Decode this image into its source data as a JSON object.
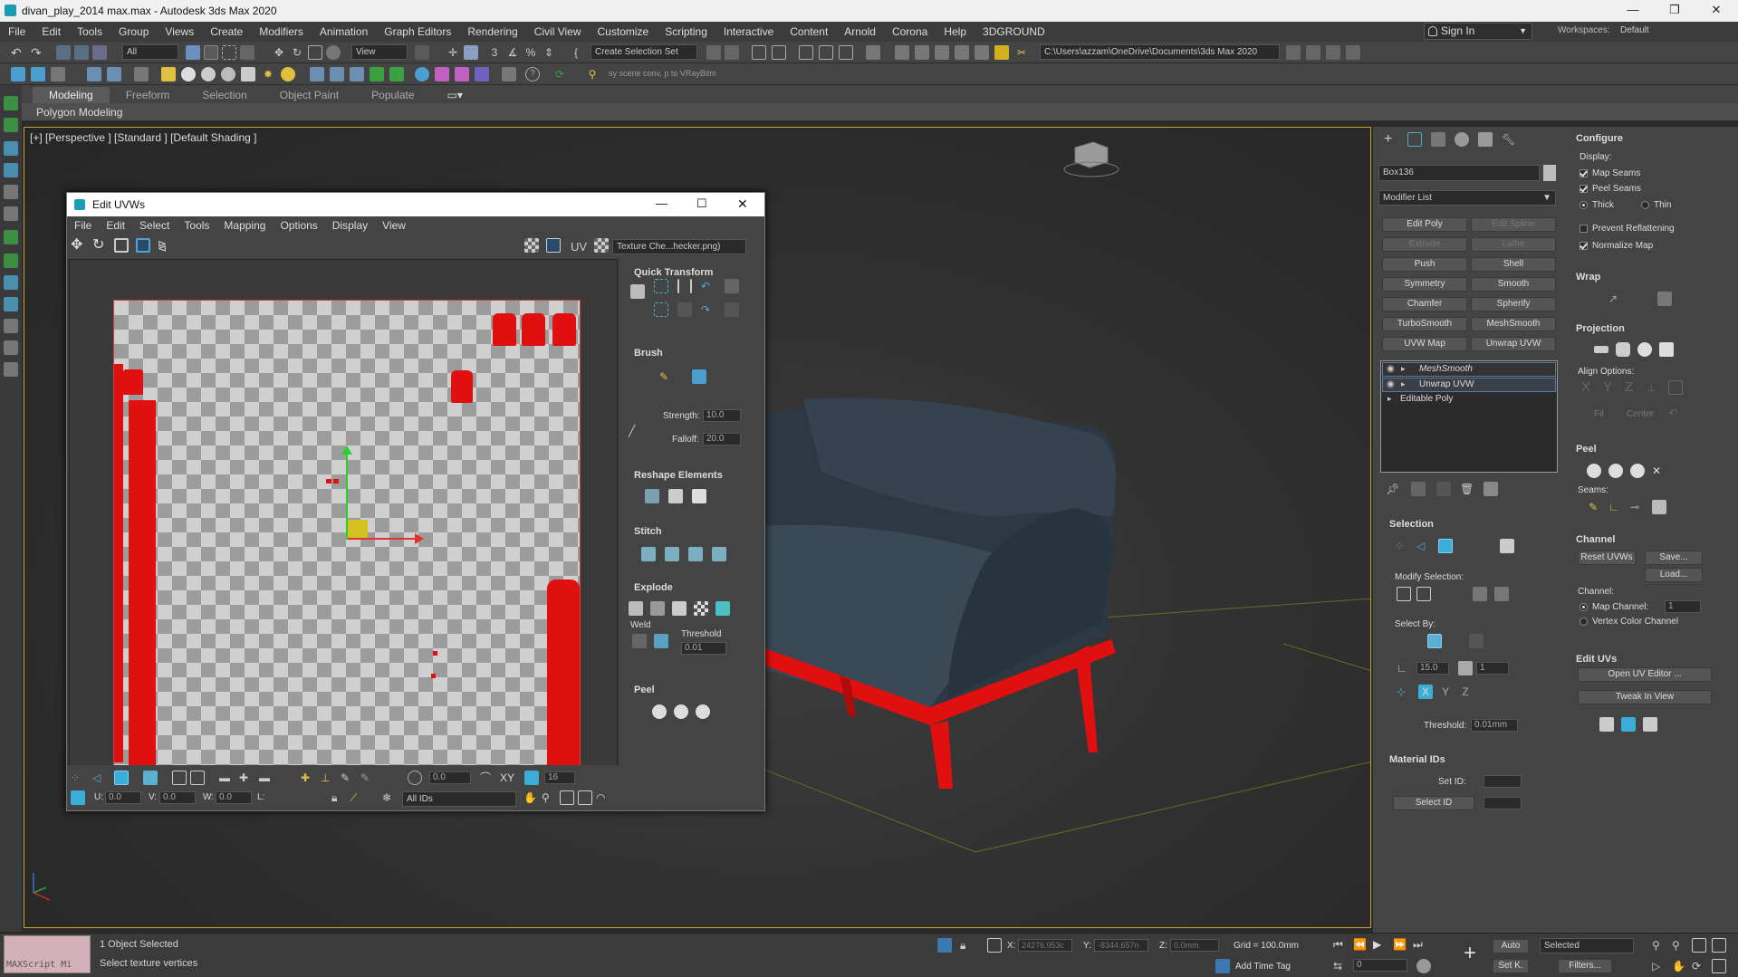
{
  "app": {
    "title": "divan_play_2014 max.max - Autodesk 3ds Max 2020"
  },
  "menu": [
    "File",
    "Edit",
    "Tools",
    "Group",
    "Views",
    "Create",
    "Modifiers",
    "Animation",
    "Graph Editors",
    "Rendering",
    "Civil View",
    "Customize",
    "Scripting",
    "Interactive",
    "Content",
    "Arnold",
    "Corona",
    "Help",
    "3DGROUND"
  ],
  "account": {
    "sign_in": "Sign In",
    "workspaces_label": "Workspaces:",
    "workspace": "Default"
  },
  "toolbar": {
    "filter": "All",
    "ref_coord": "View",
    "selection_set": "Create Selection Set",
    "path": "C:\\Users\\azzam\\OneDrive\\Documents\\3ds Max 2020",
    "scene_conv": "sy scene conv, p to VRayBitm"
  },
  "ribbon": {
    "tabs": [
      "Modeling",
      "Freeform",
      "Selection",
      "Object Paint",
      "Populate"
    ],
    "sub": "Polygon Modeling"
  },
  "viewport": {
    "label": "[+] [Perspective ] [Standard ] [Default Shading ]"
  },
  "uv_editor": {
    "title": "Edit UVWs",
    "menu": [
      "File",
      "Edit",
      "Select",
      "Tools",
      "Mapping",
      "Options",
      "Display",
      "View"
    ],
    "uv_label": "UV",
    "texture": "Texture Che...hecker.png)",
    "quick_transform": "Quick Transform",
    "brush": "Brush",
    "strength_label": "Strength:",
    "strength": "10.0",
    "falloff_label": "Falloff:",
    "falloff": "20.0",
    "reshape": "Reshape Elements",
    "stitch": "Stitch",
    "explode": "Explode",
    "weld": "Weld",
    "threshold_label": "Threshold",
    "threshold": "0.01",
    "peel": "Peel",
    "bottom": {
      "u_label": "U:",
      "u": "0.0",
      "v_label": "V:",
      "v": "0.0",
      "w_label": "W:",
      "w": "0.0",
      "l_label": "L:",
      "ids": "All IDs",
      "angle": "0.0",
      "grid": "16",
      "xy": "XY"
    }
  },
  "command_panel": {
    "object_name": "Box136",
    "modifier_list": "Modifier List",
    "buttons": [
      [
        "Edit Poly",
        "Edit Spline"
      ],
      [
        "Extrude",
        "Lathe"
      ],
      [
        "Push",
        "Shell"
      ],
      [
        "Symmetry",
        "Smooth"
      ],
      [
        "Chamfer",
        "Spherify"
      ],
      [
        "TurboSmooth",
        "MeshSmooth"
      ],
      [
        "UVW Map",
        "Unwrap UVW"
      ]
    ],
    "stack": [
      "MeshSmooth",
      "Unwrap UVW",
      "Editable Poly"
    ],
    "selection": {
      "title": "Selection",
      "modify": "Modify Selection:",
      "select_by": "Select By:",
      "angle": "15.0",
      "count": "1",
      "threshold_label": "Threshold:",
      "threshold": "0.01mm"
    },
    "material_ids": {
      "title": "Material IDs",
      "set_id": "Set ID:",
      "select_id": "Select ID"
    },
    "configure": {
      "title": "Configure",
      "display": "Display:",
      "map_seams": "Map Seams",
      "peel_seams": "Peel Seams",
      "thick": "Thick",
      "thin": "Thin",
      "prevent": "Prevent Reflattening",
      "normalize": "Normalize Map"
    },
    "wrap": "Wrap",
    "projection": "Projection",
    "align_options": "Align Options:",
    "fit": "Fit",
    "center": "Center",
    "peel": {
      "title": "Peel",
      "seams": "Seams:"
    },
    "channel": {
      "title": "Channel",
      "reset": "Reset UVWs",
      "save": "Save...",
      "load": "Load...",
      "channel_label": "Channel:",
      "map_channel": "Map Channel:",
      "map_channel_val": "1",
      "vertex_color": "Vertex Color Channel"
    },
    "edit_uvs": {
      "title": "Edit UVs",
      "open": "Open UV Editor ...",
      "tweak": "Tweak In View"
    }
  },
  "status": {
    "maxscript": "MAXScript Mi",
    "selected": "1 Object Selected",
    "prompt": "Select texture vertices",
    "x_label": "X:",
    "x": "24276.953c",
    "y_label": "Y:",
    "y": "-8344.657n",
    "z_label": "Z:",
    "z": "0.0mm",
    "grid": "Grid = 100.0mm",
    "add_time_tag": "Add Time Tag",
    "auto": "Auto",
    "set_k": "Set K.",
    "selected_dd": "Selected",
    "filters": "Filters...",
    "frame": "0"
  },
  "colors": {
    "accent_red": "#e01010",
    "viewport_border": "#c9a227",
    "sofa": "#2e3b47"
  }
}
